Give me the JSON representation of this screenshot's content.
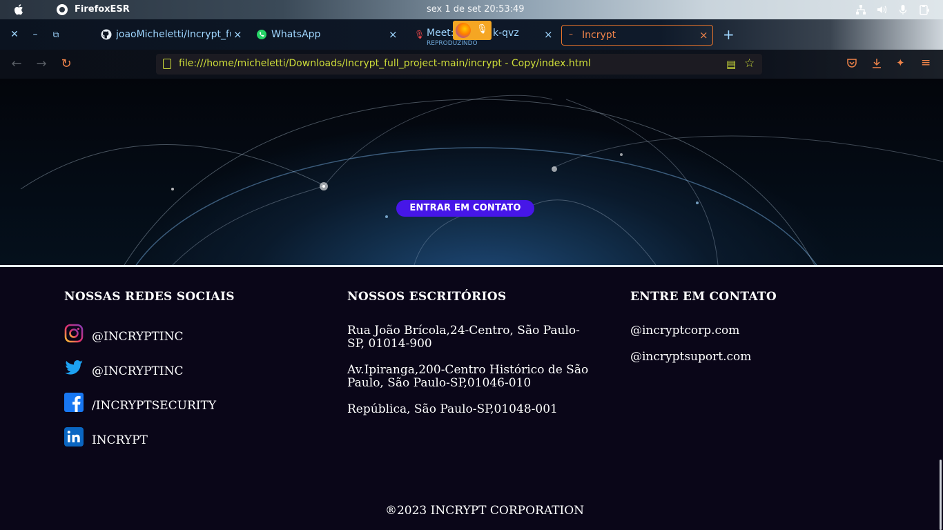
{
  "os": {
    "app_name": "FirefoxESR",
    "clock": "sex 1 de set  20:53:49"
  },
  "tabs": [
    {
      "label": "joaoMicheletti/Incrypt_fu",
      "close": "×"
    },
    {
      "label": "WhatsApp",
      "close": "×"
    },
    {
      "label": "Meet: ",
      "sub": "REPRODUZINDO",
      "label_tail": "k-qvz",
      "close": "×"
    },
    {
      "label": "Incrypt",
      "close": "×"
    }
  ],
  "new_tab": "+",
  "url": "file:///home/micheletti/Downloads/Incrypt_full_project-main/incrypt - Copy/index.html",
  "hero": {
    "cta_label": "ENTRAR EM CONTATO"
  },
  "footer": {
    "social_title": "NOSSAS REDES SOCIAIS",
    "social": [
      {
        "handle": "@INCRYPTINC",
        "icon": "instagram-icon"
      },
      {
        "handle": "@INCRYPTINC",
        "icon": "twitter-icon"
      },
      {
        "handle": "/INCRYPTSECURITY",
        "icon": "facebook-icon"
      },
      {
        "handle": "INCRYPT",
        "icon": "linkedin-icon"
      }
    ],
    "offices_title": "NOSSOS ESCRITÓRIOS",
    "offices": [
      "Rua João Brícola,24-Centro, São Paulo-SP, 01014-900",
      "Av.Ipiranga,200-Centro Histórico de São Paulo, São Paulo-SP,01046-010",
      "República, São Paulo-SP,01048-001"
    ],
    "contact_title": "ENTRE EM CONTATO",
    "contacts": [
      "@incryptcorp.com",
      "@incryptsuport.com"
    ],
    "copyright": "®2023 INCRYPT CORPORATION"
  },
  "colors": {
    "cta": "#4616e8",
    "footer_bg": "#0a0618",
    "url_text": "#cddc39",
    "active_tab": "#f0844a"
  }
}
